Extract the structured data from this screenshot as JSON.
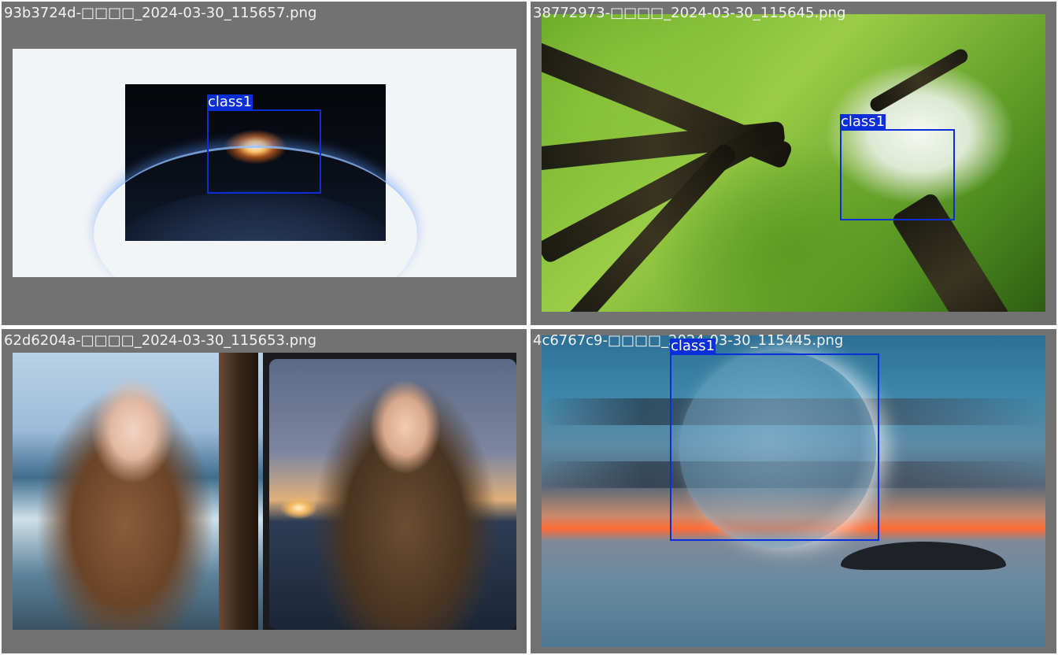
{
  "grid": {
    "cells": [
      {
        "filename": "93b3724d-□□□□_2024-03-30_115657.png",
        "detection": {
          "label": "class1"
        }
      },
      {
        "filename": "38772973-□□□□_2024-03-30_115645.png",
        "detection": {
          "label": "class1"
        }
      },
      {
        "filename": "62d6204a-□□□□_2024-03-30_115653.png"
      },
      {
        "filename": "4c6767c9-□□□□_2024-03-30_115445.png",
        "detection": {
          "label": "class1"
        }
      }
    ]
  },
  "colors": {
    "detection_box": "#0a2fd8",
    "cell_background": "#727272",
    "filename_text": "#f2f2f2"
  }
}
